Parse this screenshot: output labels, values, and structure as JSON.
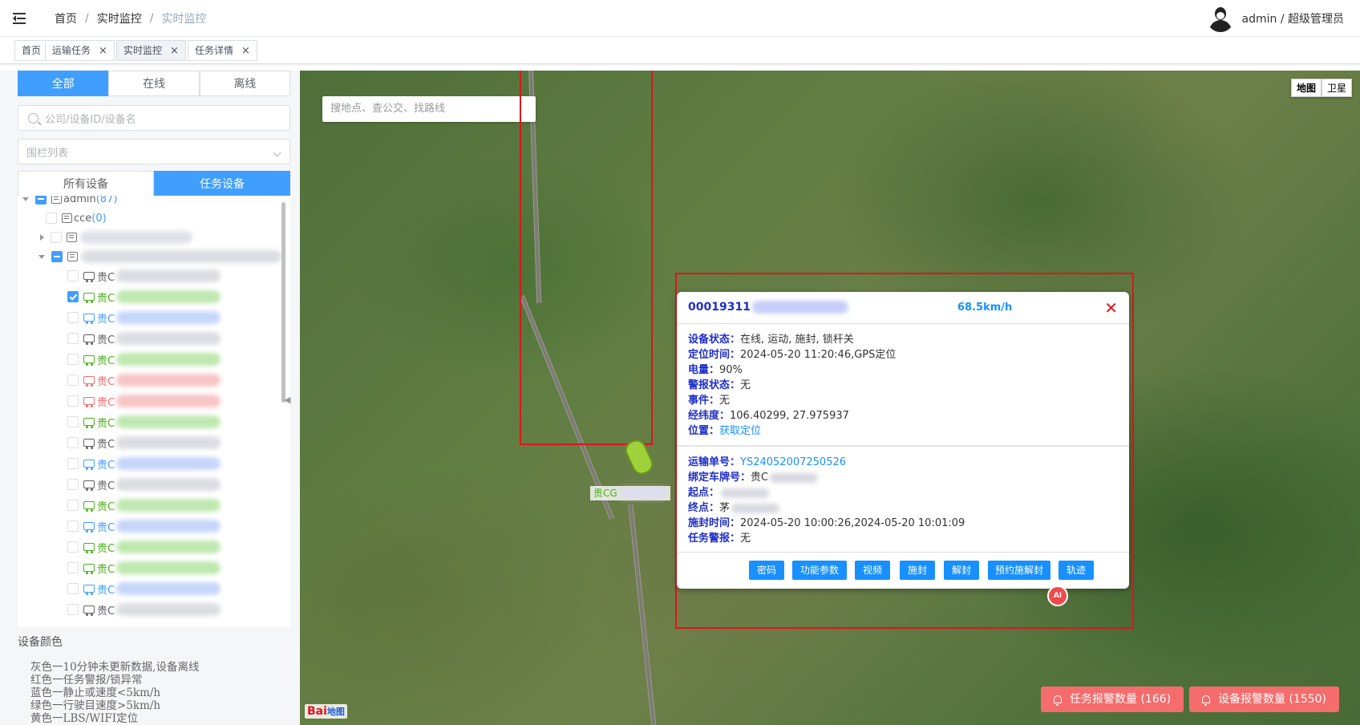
{
  "header": {
    "breadcrumbs": [
      "首页",
      "实时监控",
      "实时监控"
    ],
    "separator": "/",
    "user": "admin / 超级管理员"
  },
  "tabs": [
    {
      "label": "首页",
      "closable": false
    },
    {
      "label": "运输任务",
      "closable": true
    },
    {
      "label": "实时监控",
      "closable": true,
      "active": true
    },
    {
      "label": "任务详情",
      "closable": true
    }
  ],
  "close_glyph": "×",
  "sidebar": {
    "status_filters": [
      "全部",
      "在线",
      "离线"
    ],
    "search_placeholder": "公司/设备ID/设备名",
    "fence_placeholder": "围栏列表",
    "device_tabs": [
      "所有设备",
      "任务设备"
    ],
    "tree": {
      "root_label": "admin",
      "root_count": "(87)",
      "cce_label": "cce",
      "cce_count": "(0)",
      "vehicle_prefix": "贵C"
    },
    "legend_title": "设备颜色",
    "legend_lines": [
      "灰色一10分钟未更新数据,设备离线",
      "红色一任务警报/锁异常",
      "蓝色一静止或速度<5km/h",
      "绿色一行驶目速度>5km/h",
      "黄色一LBS/WIFI定位"
    ]
  },
  "colors": {
    "gray": "#606266",
    "red": "#f56c6c",
    "blue": "#409eff",
    "green": "#4caf1a",
    "accent": "#409eff",
    "alert": "#f56c6c"
  },
  "map": {
    "search_placeholder": "搜地点、查公交、找路线",
    "types": [
      "地图",
      "卫星"
    ],
    "car_label": "贵CG",
    "logo_text": "Bai",
    "logo_suffix": "地图"
  },
  "popup": {
    "device_id": "00019311",
    "speed": "68.5km/h",
    "close": "✕",
    "status_fields": [
      {
        "k": "设备状态：",
        "v": "在线, 运动, 施封, 锁杆关"
      },
      {
        "k": "定位时间：",
        "v": "2024-05-20 11:20:46,GPS定位"
      },
      {
        "k": "电量：",
        "v": "90%"
      },
      {
        "k": "警报状态：",
        "v": "无"
      },
      {
        "k": "事件：",
        "v": "无"
      },
      {
        "k": "经纬度：",
        "v": "106.40299, 27.975937"
      },
      {
        "k": "位置：",
        "v": "获取定位"
      }
    ],
    "task_fields": [
      {
        "k": "运输单号：",
        "v": "YS24052007250526"
      },
      {
        "k": "绑定车牌号：",
        "v": "贵C"
      },
      {
        "k": "起点：",
        "v": ""
      },
      {
        "k": "终点：",
        "v": "茅"
      },
      {
        "k": "施封时间：",
        "v": "2024-05-20 10:00:26,2024-05-20 10:01:09"
      },
      {
        "k": "任务警报：",
        "v": "无"
      }
    ],
    "actions": [
      "密码",
      "功能参数",
      "视频",
      "施封",
      "解封",
      "预约施解封",
      "轨迹"
    ]
  },
  "ai_badge": "AI",
  "alerts": {
    "task": "任务报警数量 (166)",
    "device": "设备报警数量 (1550)"
  }
}
